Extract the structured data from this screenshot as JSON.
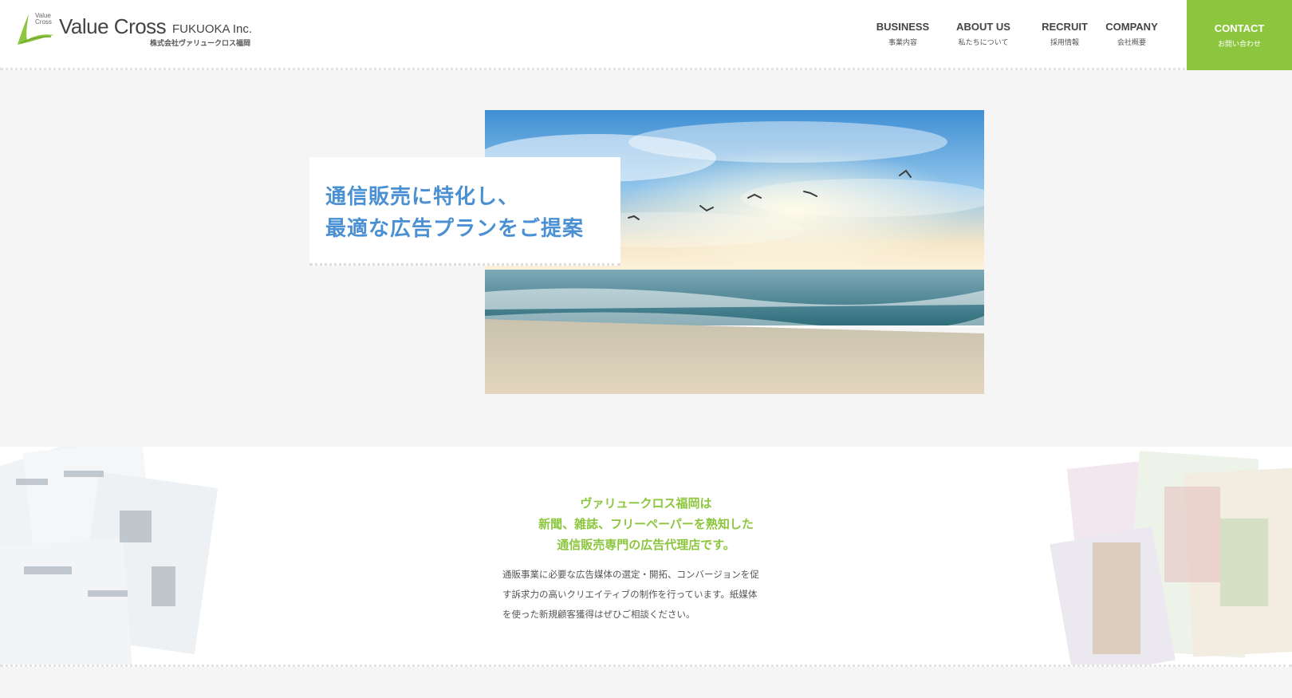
{
  "header": {
    "logo": {
      "mark_text": "Value Cross",
      "name": "Value Cross",
      "suffix": "FUKUOKA Inc.",
      "jp_name": "株式会社ヴァリュークロス福岡"
    },
    "nav": [
      {
        "en": "BUSINESS",
        "jp": "事業内容"
      },
      {
        "en": "ABOUT US",
        "jp": "私たちについて"
      },
      {
        "en": "RECRUIT",
        "jp": "採用情報"
      },
      {
        "en": "COMPANY",
        "jp": "会社概要"
      }
    ],
    "contact": {
      "en": "CONTACT",
      "jp": "お問い合わせ"
    }
  },
  "hero": {
    "lines": [
      "通信販売に特化し、",
      "最適な広告プランをご提案"
    ]
  },
  "intro": {
    "heading": [
      "ヴァリュークロス福岡は",
      "新聞、雑誌、フリーペーパーを熟知した",
      "通信販売専門の広告代理店です。"
    ],
    "body": [
      "通販事業に必要な広告媒体の選定・開拓、コンバージョンを促",
      "す訴求力の高いクリエイティブの制作を行っています。紙媒体",
      "を使った新規顧客獲得はぜひご相談ください。"
    ]
  },
  "colors": {
    "accent_green": "#8cc63f",
    "headline_blue": "#4a90d2",
    "page_bg": "#f5f5f5"
  }
}
